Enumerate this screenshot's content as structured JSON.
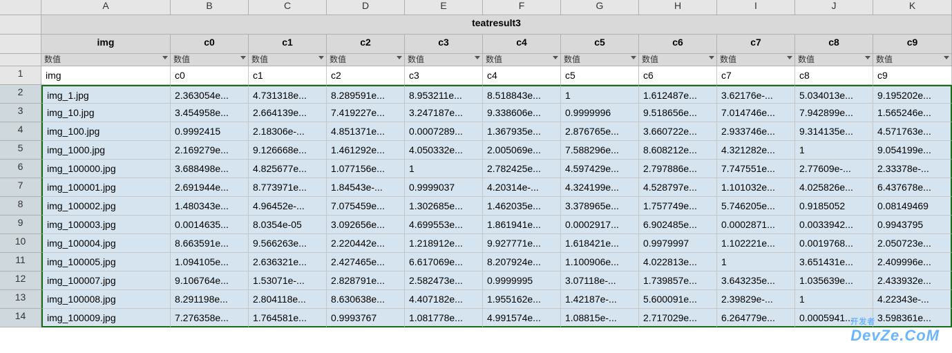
{
  "columns": [
    "A",
    "B",
    "C",
    "D",
    "E",
    "F",
    "G",
    "H",
    "I",
    "J",
    "K"
  ],
  "tableTitle": "teatresult3",
  "headers": [
    "img",
    "c0",
    "c1",
    "c2",
    "c3",
    "c4",
    "c5",
    "c6",
    "c7",
    "c8",
    "c9"
  ],
  "filterLabel": "数值",
  "headerRow": [
    "img",
    "c0",
    "c1",
    "c2",
    "c3",
    "c4",
    "c5",
    "c6",
    "c7",
    "c8",
    "c9"
  ],
  "rows": [
    {
      "n": 2,
      "d": [
        "img_1.jpg",
        "2.363054e...",
        "4.731318e...",
        "8.289591e...",
        "8.953211e...",
        "8.518843e...",
        "1",
        "1.612487e...",
        "3.62176e-...",
        "5.034013e...",
        "9.195202e..."
      ]
    },
    {
      "n": 3,
      "d": [
        "img_10.jpg",
        "3.454958e...",
        "2.664139e...",
        "7.419227e...",
        "3.247187e...",
        "9.338606e...",
        "0.9999996",
        "9.518656e...",
        "7.014746e...",
        "7.942899e...",
        "1.565246e..."
      ]
    },
    {
      "n": 4,
      "d": [
        "img_100.jpg",
        "0.9992415",
        "2.18306e-...",
        "4.851371e...",
        "0.0007289...",
        "1.367935e...",
        "2.876765e...",
        "3.660722e...",
        "2.933746e...",
        "9.314135e...",
        "4.571763e..."
      ]
    },
    {
      "n": 5,
      "d": [
        "img_1000.jpg",
        "2.169279e...",
        "9.126668e...",
        "1.461292e...",
        "4.050332e...",
        "2.005069e...",
        "7.588296e...",
        "8.608212e...",
        "4.321282e...",
        "1",
        "9.054199e..."
      ]
    },
    {
      "n": 6,
      "d": [
        "img_100000.jpg",
        "3.688498e...",
        "4.825677e...",
        "1.077156e...",
        "1",
        "2.782425e...",
        "4.597429e...",
        "2.797886e...",
        "7.747551e...",
        "2.77609e-...",
        "2.33378e-..."
      ]
    },
    {
      "n": 7,
      "d": [
        "img_100001.jpg",
        "2.691944e...",
        "8.773971e...",
        "1.84543e-...",
        "0.9999037",
        "4.20314e-...",
        "4.324199e...",
        "4.528797e...",
        "1.101032e...",
        "4.025826e...",
        "6.437678e..."
      ]
    },
    {
      "n": 8,
      "d": [
        "img_100002.jpg",
        "1.480343e...",
        "4.96452e-...",
        "7.075459e...",
        "1.302685e...",
        "1.462035e...",
        "3.378965e...",
        "1.757749e...",
        "5.746205e...",
        "0.9185052",
        "0.08149469"
      ]
    },
    {
      "n": 9,
      "d": [
        "img_100003.jpg",
        "0.0014635...",
        "8.0354e-05",
        "3.092656e...",
        "4.699553e...",
        "1.861941e...",
        "0.0002917...",
        "6.902485e...",
        "0.0002871...",
        "0.0033942...",
        "0.9943795"
      ]
    },
    {
      "n": 10,
      "d": [
        "img_100004.jpg",
        "8.663591e...",
        "9.566263e...",
        "2.220442e...",
        "1.218912e...",
        "9.927771e...",
        "1.618421e...",
        "0.9979997",
        "1.102221e...",
        "0.0019768...",
        "2.050723e..."
      ]
    },
    {
      "n": 11,
      "d": [
        "img_100005.jpg",
        "1.094105e...",
        "2.636321e...",
        "2.427465e...",
        "6.617069e...",
        "8.207924e...",
        "1.100906e...",
        "4.022813e...",
        "1",
        "3.651431e...",
        "2.409996e..."
      ]
    },
    {
      "n": 12,
      "d": [
        "img_100007.jpg",
        "9.106764e...",
        "1.53071e-...",
        "2.828791e...",
        "2.582473e...",
        "0.9999995",
        "3.07118e-...",
        "1.739857e...",
        "3.643235e...",
        "1.035639e...",
        "2.433932e..."
      ]
    },
    {
      "n": 13,
      "d": [
        "img_100008.jpg",
        "8.291198e...",
        "2.804118e...",
        "8.630638e...",
        "4.407182e...",
        "1.955162e...",
        "1.42187e-...",
        "5.600091e...",
        "2.39829e-...",
        "1",
        "4.22343e-..."
      ]
    },
    {
      "n": 14,
      "d": [
        "img_100009.jpg",
        "7.276358e...",
        "1.764581e...",
        "0.9993767",
        "1.081778e...",
        "4.991574e...",
        "1.08815e-...",
        "2.717029e...",
        "6.264779e...",
        "0.0005941...",
        "3.598361e..."
      ]
    }
  ],
  "watermark": "DevZe.CoM",
  "watermarkSub": "开发者"
}
